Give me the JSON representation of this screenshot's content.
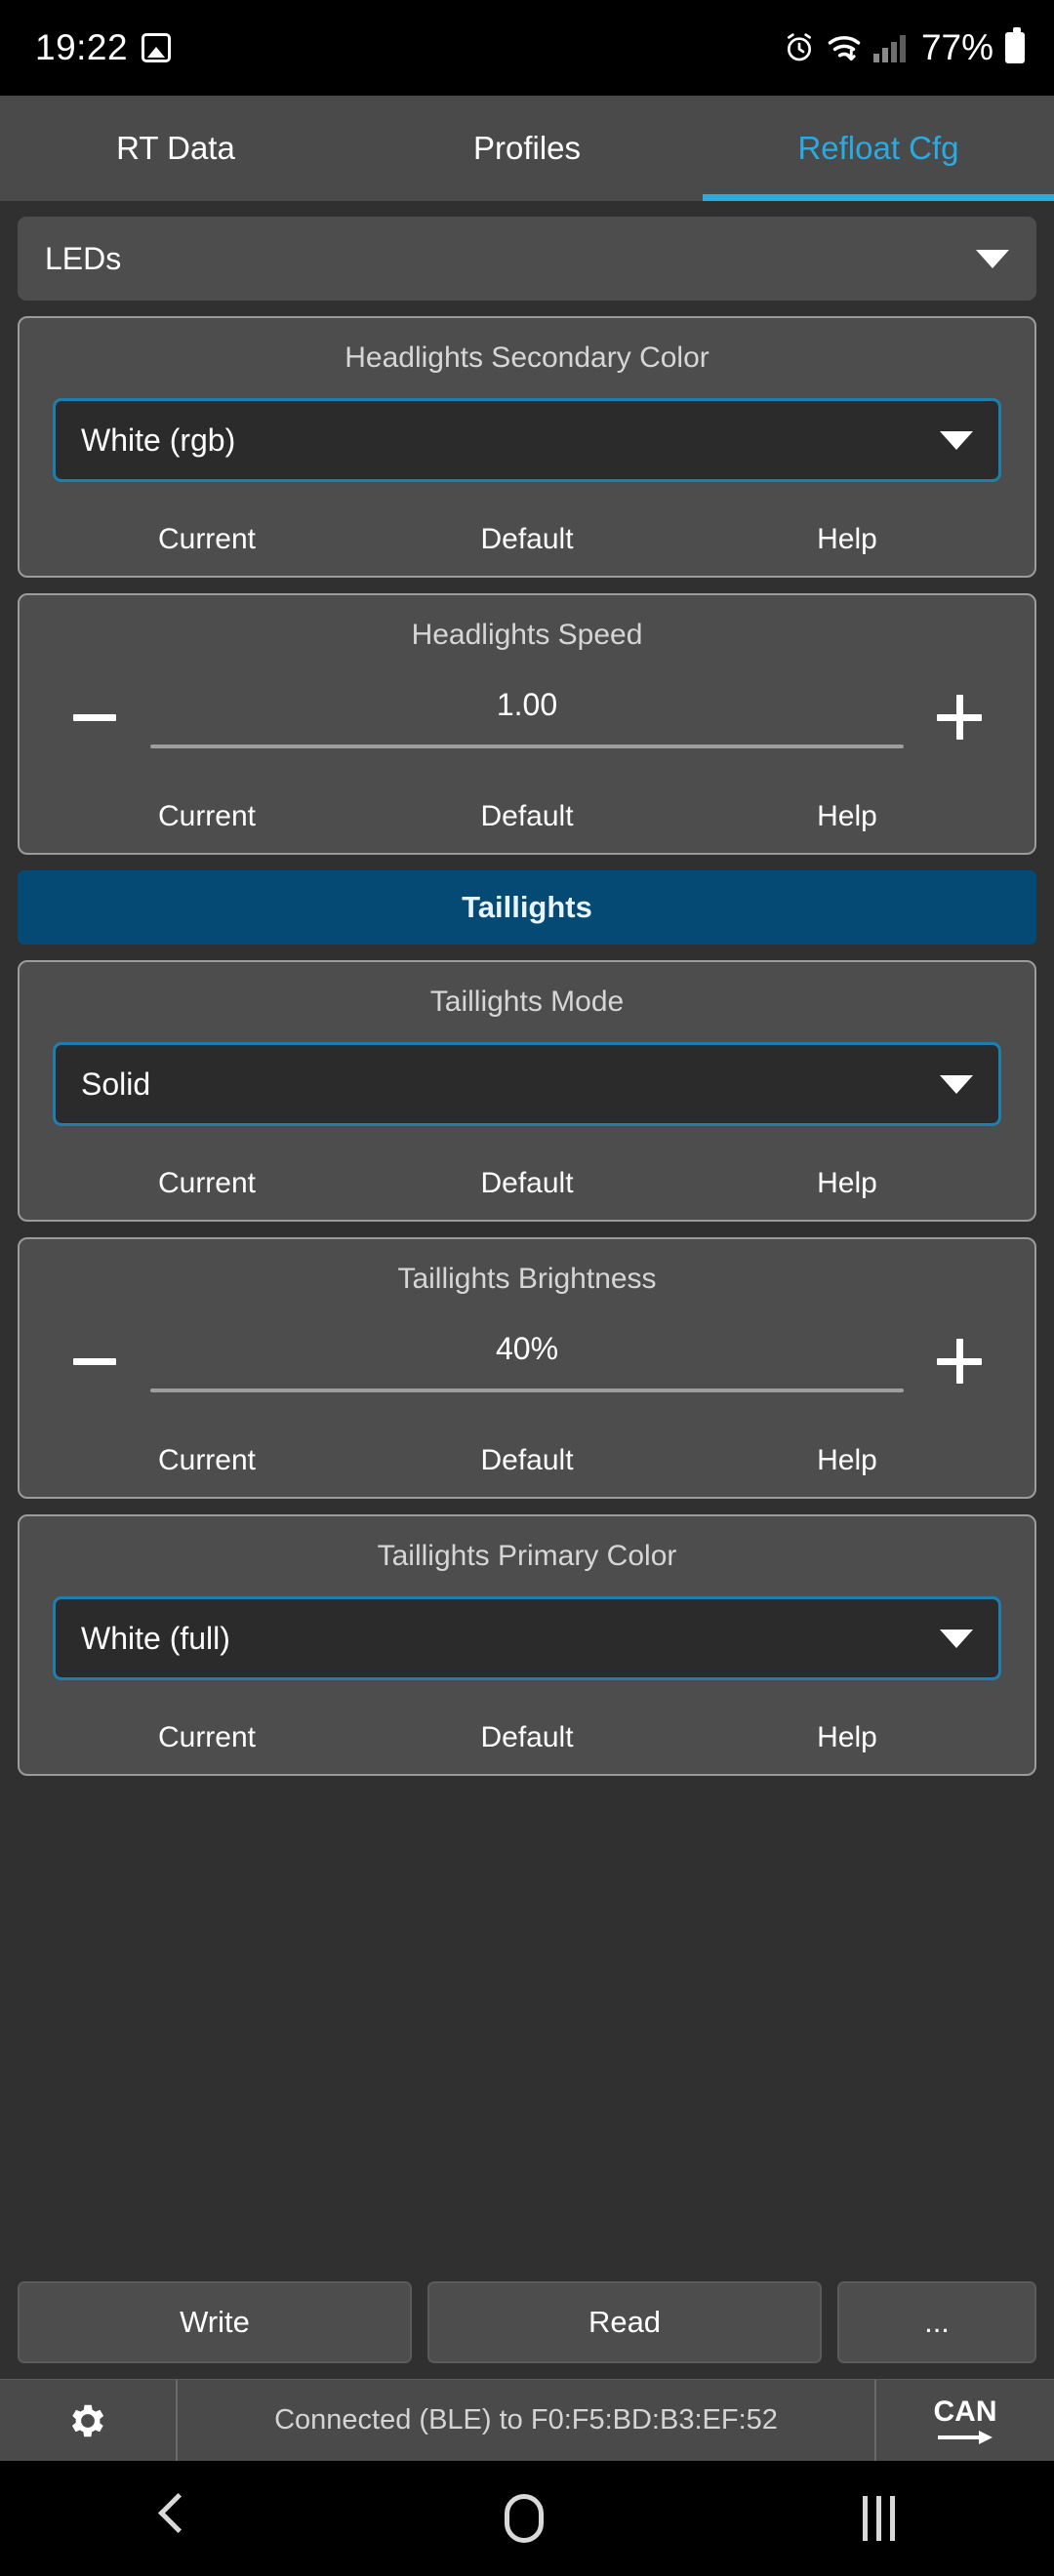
{
  "system_bar": {
    "time": "19:22",
    "image_icon": "image-icon",
    "alarm_icon": "alarm-icon",
    "wifi_icon": "wifi-icon",
    "signal_icon": "signal-icon",
    "battery_percent": "77%",
    "battery_icon": "battery-icon"
  },
  "tabs": [
    {
      "label": "RT Data",
      "active": false
    },
    {
      "label": "Profiles",
      "active": false
    },
    {
      "label": "Refloat Cfg",
      "active": true
    }
  ],
  "group_select": {
    "value": "LEDs",
    "caret_icon": "chevron-down-icon"
  },
  "actions_row": {
    "current": "Current",
    "default": "Default",
    "help": "Help"
  },
  "cards": [
    {
      "id": "headlights-secondary-color",
      "title": "Headlights Secondary Color",
      "type": "dropdown",
      "value": "White (rgb)"
    },
    {
      "id": "headlights-speed",
      "title": "Headlights Speed",
      "type": "stepper",
      "value": "1.00",
      "minus_icon": "minus-icon",
      "plus_icon": "plus-icon"
    }
  ],
  "section_header": {
    "label": "Taillights"
  },
  "cards2": [
    {
      "id": "taillights-mode",
      "title": "Taillights Mode",
      "type": "dropdown",
      "value": "Solid"
    },
    {
      "id": "taillights-brightness",
      "title": "Taillights Brightness",
      "type": "stepper",
      "value": "40%",
      "minus_icon": "minus-icon",
      "plus_icon": "plus-icon"
    },
    {
      "id": "taillights-primary-color",
      "title": "Taillights Primary Color",
      "type": "dropdown",
      "value": "White (full)"
    }
  ],
  "bottom_buttons": {
    "write": "Write",
    "read": "Read",
    "more": "..."
  },
  "status": {
    "gear_icon": "gear-icon",
    "connection_text": "Connected (BLE) to F0:F5:BD:B3:EF:52",
    "can_label": "CAN",
    "can_arrow_icon": "arrow-right-icon"
  },
  "nav_bar": {
    "back_icon": "back-icon",
    "home_icon": "home-icon",
    "recents_icon": "recents-icon"
  },
  "colors": {
    "accent": "#29abe2",
    "section_header_bg": "#044a74",
    "page_bg": "#303030",
    "card_bg": "#4d4d4d",
    "combo_bg": "#2b2b2b",
    "combo_border": "#1d7fae"
  }
}
